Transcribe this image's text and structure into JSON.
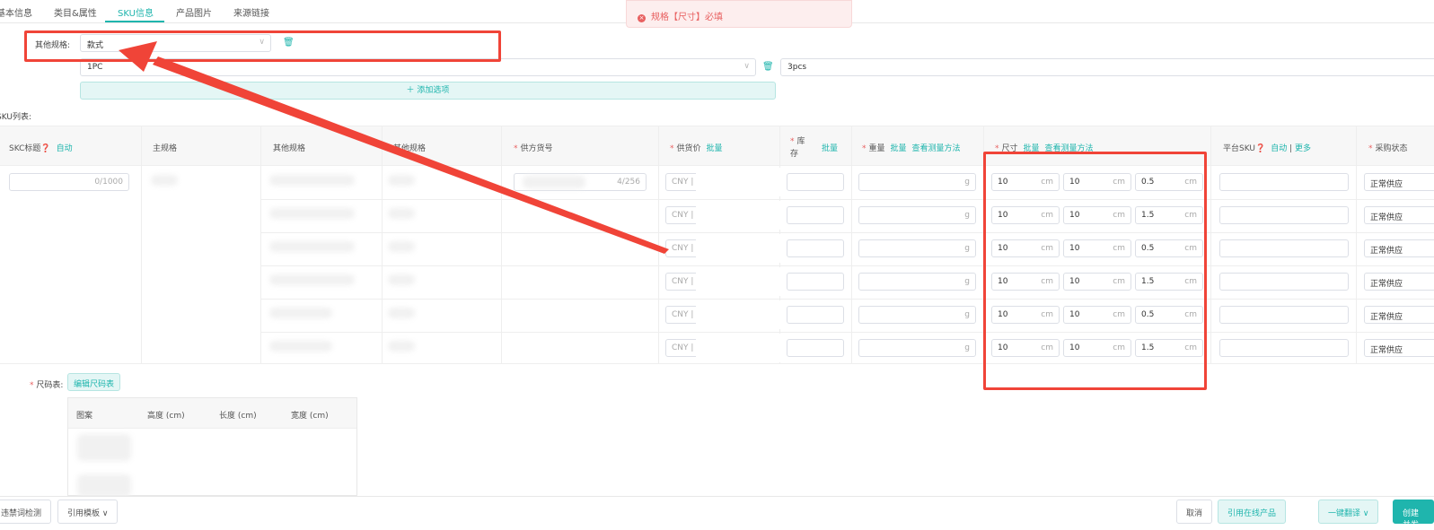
{
  "tabs": [
    {
      "label": "基本信息"
    },
    {
      "label": "类目&属性"
    },
    {
      "label": "SKU信息"
    },
    {
      "label": "产品图片"
    },
    {
      "label": "来源链接"
    }
  ],
  "toast": {
    "icon": "error-icon",
    "message": "规格【尺寸】必填"
  },
  "other_spec": {
    "label": "其他规格:",
    "value": "款式",
    "option_value": "1PC",
    "option2_value": "3pcs",
    "add_option": "添加选项"
  },
  "sku_list_label": "SKU列表:",
  "columns": {
    "skc_title": "SKC标题",
    "skc_auto": "自动",
    "main_spec": "主规格",
    "other_spec1": "其他规格",
    "other_spec2": "其他规格",
    "supplier_no": "供方货号",
    "price": "供货价",
    "price_batch": "批量",
    "stock": "库存",
    "stock_batch": "批量",
    "weight": "重量",
    "weight_batch": "批量",
    "weight_method": "查看测量方法",
    "size": "尺寸",
    "size_batch": "批量",
    "size_method": "查看测量方法",
    "platform_sku": "平台SKU",
    "platform_auto": "自动",
    "platform_more": "更多",
    "purchase_status": "采购状态"
  },
  "skc_counter": "0/1000",
  "supplier_counter": "4/256",
  "currency": "CNY",
  "weight_unit": "g",
  "size_unit": "cm",
  "rows": [
    {
      "l": "10",
      "w": "10",
      "h": "0.5",
      "status": "正常供应"
    },
    {
      "l": "10",
      "w": "10",
      "h": "1.5",
      "status": "正常供应"
    },
    {
      "l": "10",
      "w": "10",
      "h": "0.5",
      "status": "正常供应"
    },
    {
      "l": "10",
      "w": "10",
      "h": "1.5",
      "status": "正常供应"
    },
    {
      "l": "10",
      "w": "10",
      "h": "0.5",
      "status": "正常供应"
    },
    {
      "l": "10",
      "w": "10",
      "h": "1.5",
      "status": "正常供应"
    }
  ],
  "size_chart": {
    "label": "尺码表:",
    "edit_button": "编辑尺码表",
    "headers": [
      "图案",
      "高度 (cm)",
      "长度 (cm)",
      "宽度 (cm)"
    ]
  },
  "footer": {
    "left": [
      "违禁词检测",
      "引用模板"
    ],
    "right": [
      "取消",
      "引用在线产品",
      "一键翻译",
      "创建并发"
    ]
  }
}
